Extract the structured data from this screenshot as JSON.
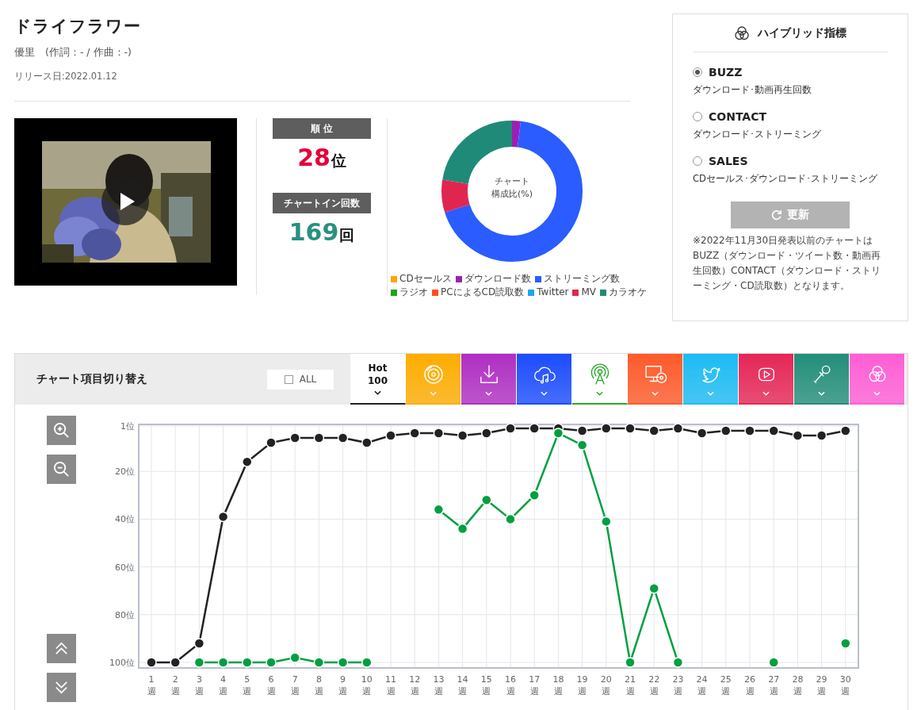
{
  "song": {
    "title": "ドライフラワー",
    "credits": "優里　(作詞：- / 作曲：-)",
    "release": "リリース日:2022.01.12"
  },
  "rank": {
    "label": "順 位",
    "value": "28",
    "unit": "位"
  },
  "chart_in": {
    "label": "チャートイン回数",
    "value": "169",
    "unit": "回"
  },
  "composition": {
    "center_text": [
      "チャート",
      "構成比(%)"
    ],
    "legend": [
      {
        "label": "CDセールス",
        "color": "#ffa400"
      },
      {
        "label": "ダウンロード数",
        "color": "#9c1fb5"
      },
      {
        "label": "ストリーミング数",
        "color": "#2a5cff"
      },
      {
        "label": "ラジオ",
        "color": "#19a519"
      },
      {
        "label": "PCによるCD読取数",
        "color": "#ff5020"
      },
      {
        "label": "Twitter",
        "color": "#1aa7f0"
      },
      {
        "label": "MV",
        "color": "#e0264f"
      },
      {
        "label": "カラオケ",
        "color": "#208a78"
      }
    ]
  },
  "hybrid": {
    "title": "ハイブリッド指標",
    "options": [
      {
        "label": "BUZZ",
        "description": "ダウンロード･動画再生回数",
        "selected": true
      },
      {
        "label": "CONTACT",
        "description": "ダウンロード･ストリーミング",
        "selected": false
      },
      {
        "label": "SALES",
        "description": "CDセールス･ダウンロード･ストリーミング",
        "selected": false
      }
    ],
    "button": "更新",
    "note": "※2022年11月30日発表以前のチャートはBUZZ（ダウンロード・ツイート数・動画再生回数）CONTACT（ダウンロード・ストリーミング・CD読取数）となります。"
  },
  "chart_section": {
    "title": "チャート項目切り替え",
    "all": {
      "label": "ALL",
      "checked": false
    },
    "tabs": [
      {
        "kind": "text",
        "label": "Hot 100",
        "color": "#222222",
        "selected": true
      },
      {
        "kind": "icon",
        "color": "#ffad00",
        "selected": false
      },
      {
        "kind": "icon",
        "color": "#b02fc3",
        "selected": false
      },
      {
        "kind": "icon",
        "color": "#1c4cff",
        "selected": false
      },
      {
        "kind": "icon",
        "color": "#2aa82a",
        "selected": true
      },
      {
        "kind": "icon",
        "color": "#ff5a2a",
        "selected": false
      },
      {
        "kind": "icon",
        "color": "#1cbcf5",
        "selected": false
      },
      {
        "kind": "icon",
        "color": "#e62656",
        "selected": false
      },
      {
        "kind": "icon",
        "color": "#238e7a",
        "selected": false
      },
      {
        "kind": "icon",
        "color": "#ff5ed6",
        "selected": false
      }
    ],
    "chart_data": {
      "type": "line",
      "grid": true,
      "categories": [
        "1週",
        "2週",
        "3週",
        "4週",
        "5週",
        "6週",
        "7週",
        "8週",
        "9週",
        "10週",
        "11週",
        "12週",
        "13週",
        "14週",
        "15週",
        "16週",
        "17週",
        "18週",
        "19週",
        "20週",
        "21週",
        "22週",
        "23週",
        "24週",
        "25週",
        "26週",
        "27週",
        "28週",
        "29週",
        "30週"
      ],
      "ylim": [
        100,
        1
      ],
      "yticks": [
        {
          "value": 1,
          "label": "1位"
        },
        {
          "value": 20,
          "label": "20位"
        },
        {
          "value": 40,
          "label": "40位"
        },
        {
          "value": 60,
          "label": "60位"
        },
        {
          "value": 80,
          "label": "80位"
        },
        {
          "value": 100,
          "label": "100位"
        }
      ],
      "series": [
        {
          "color": "#222222",
          "marker": true,
          "values": [
            100,
            100,
            92,
            39,
            16,
            8,
            6,
            6,
            6,
            8,
            5,
            4,
            4,
            5,
            4,
            2,
            2,
            2,
            3,
            2,
            2,
            3,
            2,
            4,
            3,
            3,
            3,
            5,
            5,
            3
          ]
        },
        {
          "color": "#00a040",
          "marker": true,
          "values": [
            null,
            null,
            100,
            100,
            100,
            100,
            98,
            100,
            100,
            100,
            null,
            null,
            36,
            44,
            32,
            40,
            30,
            4,
            9,
            41,
            100,
            69,
            100,
            null,
            null,
            null,
            100,
            null,
            null,
            92
          ]
        }
      ]
    }
  }
}
